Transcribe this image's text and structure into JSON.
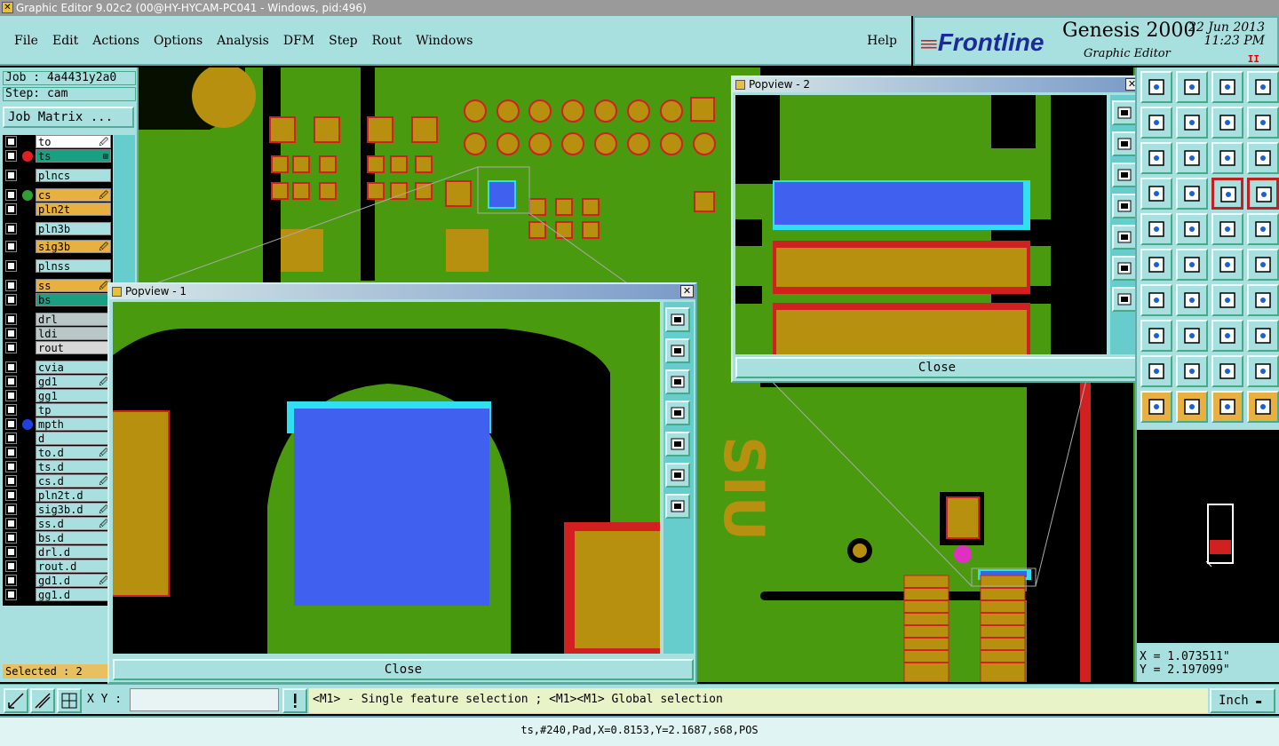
{
  "window": {
    "title": "Graphic Editor 9.02c2 (00@HY-HYCAM-PC041 - Windows, pid:496)"
  },
  "menu": {
    "items": [
      "File",
      "Edit",
      "Actions",
      "Options",
      "Analysis",
      "DFM",
      "Step",
      "Rout",
      "Windows"
    ],
    "help": "Help"
  },
  "brand": {
    "logo": "Frontline",
    "product": "Genesis 2000",
    "subtitle": "Graphic Editor",
    "date": "22 Jun 2013",
    "time": "11:23 PM",
    "marker": "II"
  },
  "job": {
    "job_label": "Job : 4a4431y2a0",
    "step_label": "Step: cam",
    "matrix_button": "Job Matrix ..."
  },
  "layers": [
    {
      "name": "to",
      "color": "#ffffff",
      "dot": "",
      "mark": "🖉"
    },
    {
      "name": "ts",
      "color": "#1aa080",
      "dot": "#e02020",
      "mark": "⊞"
    },
    {
      "name": "plncs",
      "color": "#a8e0e0",
      "dot": "",
      "mark": ""
    },
    {
      "name": "cs",
      "color": "#e8b040",
      "dot": "#30a030",
      "mark": "🖉"
    },
    {
      "name": "pln2t",
      "color": "#e8b040",
      "dot": "",
      "mark": ""
    },
    {
      "name": "pln3b",
      "color": "#a8e0e0",
      "dot": "",
      "mark": ""
    },
    {
      "name": "sig3b",
      "color": "#e8b040",
      "dot": "",
      "mark": "🖉"
    },
    {
      "name": "plnss",
      "color": "#a8e0e0",
      "dot": "",
      "mark": ""
    },
    {
      "name": "ss",
      "color": "#e8b040",
      "dot": "",
      "mark": "🖉"
    },
    {
      "name": "bs",
      "color": "#1aa080",
      "dot": "",
      "mark": ""
    },
    {
      "name": "drl",
      "color": "#b8c8c8",
      "dot": "",
      "mark": ""
    },
    {
      "name": "ldi",
      "color": "#b8c8c8",
      "dot": "",
      "mark": ""
    },
    {
      "name": "rout",
      "color": "#d8d8d8",
      "dot": "",
      "mark": ""
    },
    {
      "name": "cvia",
      "color": "#a8e0e0",
      "dot": "",
      "mark": ""
    },
    {
      "name": "gd1",
      "color": "#a8e0e0",
      "dot": "",
      "mark": "🖉"
    },
    {
      "name": "gg1",
      "color": "#a8e0e0",
      "dot": "",
      "mark": ""
    },
    {
      "name": "tp",
      "color": "#a8e0e0",
      "dot": "",
      "mark": ""
    },
    {
      "name": "mpth",
      "color": "#a8e0e0",
      "dot": "#2040e0",
      "mark": ""
    },
    {
      "name": "d",
      "color": "#a8e0e0",
      "dot": "",
      "mark": ""
    },
    {
      "name": "to.d",
      "color": "#a8e0e0",
      "dot": "",
      "mark": "🖉"
    },
    {
      "name": "ts.d",
      "color": "#a8e0e0",
      "dot": "",
      "mark": ""
    },
    {
      "name": "cs.d",
      "color": "#a8e0e0",
      "dot": "",
      "mark": "🖉"
    },
    {
      "name": "pln2t.d",
      "color": "#a8e0e0",
      "dot": "",
      "mark": ""
    },
    {
      "name": "sig3b.d",
      "color": "#a8e0e0",
      "dot": "",
      "mark": "🖉"
    },
    {
      "name": "ss.d",
      "color": "#a8e0e0",
      "dot": "",
      "mark": "🖉"
    },
    {
      "name": "bs.d",
      "color": "#a8e0e0",
      "dot": "",
      "mark": ""
    },
    {
      "name": "drl.d",
      "color": "#a8e0e0",
      "dot": "",
      "mark": ""
    },
    {
      "name": "rout.d",
      "color": "#a8e0e0",
      "dot": "",
      "mark": ""
    },
    {
      "name": "gd1.d",
      "color": "#a8e0e0",
      "dot": "",
      "mark": "🖉"
    },
    {
      "name": "gg1.d",
      "color": "#a8e0e0",
      "dot": "",
      "mark": ""
    }
  ],
  "selected": "Selected : 2",
  "popview1": {
    "title": "Popview - 1",
    "close": "Close"
  },
  "popview2": {
    "title": "Popview - 2",
    "close": "Close"
  },
  "coords": {
    "x": "X = 1.073511\"",
    "y": "Y = 2.197099\""
  },
  "cmd": {
    "xy_label": "X Y :",
    "xy_value": "",
    "prompt": "<M1> - Single feature selection ; <M1><M1> Global selection",
    "unit": "Inch",
    "unit_arrow": "▬"
  },
  "status": "ts,#240,Pad,X=0.8153,Y=2.1687,s68,POS",
  "canvas_text": "SIU"
}
